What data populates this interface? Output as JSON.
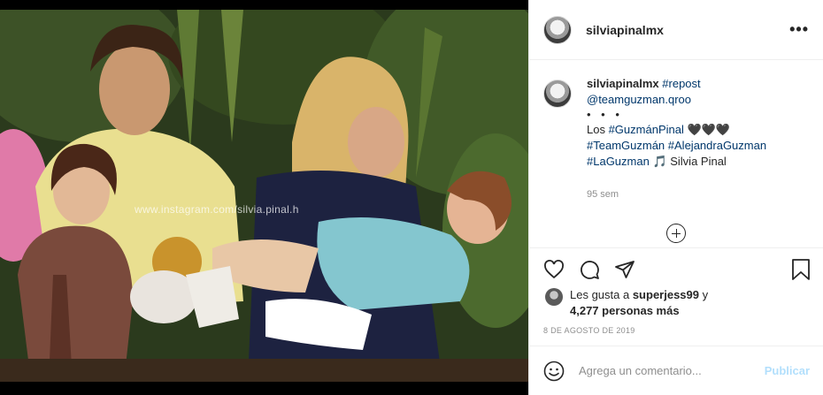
{
  "post": {
    "username": "silviapinalmx",
    "photo_watermark": "www.instagram.com/silvia.pinal.h"
  },
  "caption": {
    "username": "silviapinalmx",
    "line1_tag": "#repost",
    "line2_handle": "@teamguzman.qroo",
    "dots": "• • •",
    "line3_prefix": "Los ",
    "line3_tag": "#GuzmánPinal",
    "line3_hearts": " 🖤🖤🖤",
    "line4_tag1": "#TeamGuzmán",
    "line4_tag2": "#AlejandraGuzman",
    "line5_tag": "#LaGuzman",
    "line5_suffix": " 🎵 Silvia Pinal",
    "time": "95 sem"
  },
  "likes": {
    "prefix": "Les gusta a ",
    "user": "superjess99",
    "joiner": " y",
    "count": "4,277 personas más"
  },
  "date": "8 DE AGOSTO DE 2019",
  "comment": {
    "placeholder": "Agrega un comentario...",
    "publish_label": "Publicar"
  },
  "icons": {
    "more": "more-options-icon",
    "like": "heart-icon",
    "comment": "comment-icon",
    "share": "share-icon",
    "save": "bookmark-icon",
    "emoji": "emoji-icon",
    "load_more": "plus-circle-icon"
  },
  "colors": {
    "hashtag": "#00376b",
    "muted": "#8e8e8e",
    "publish_disabled": "#b2dffc"
  }
}
